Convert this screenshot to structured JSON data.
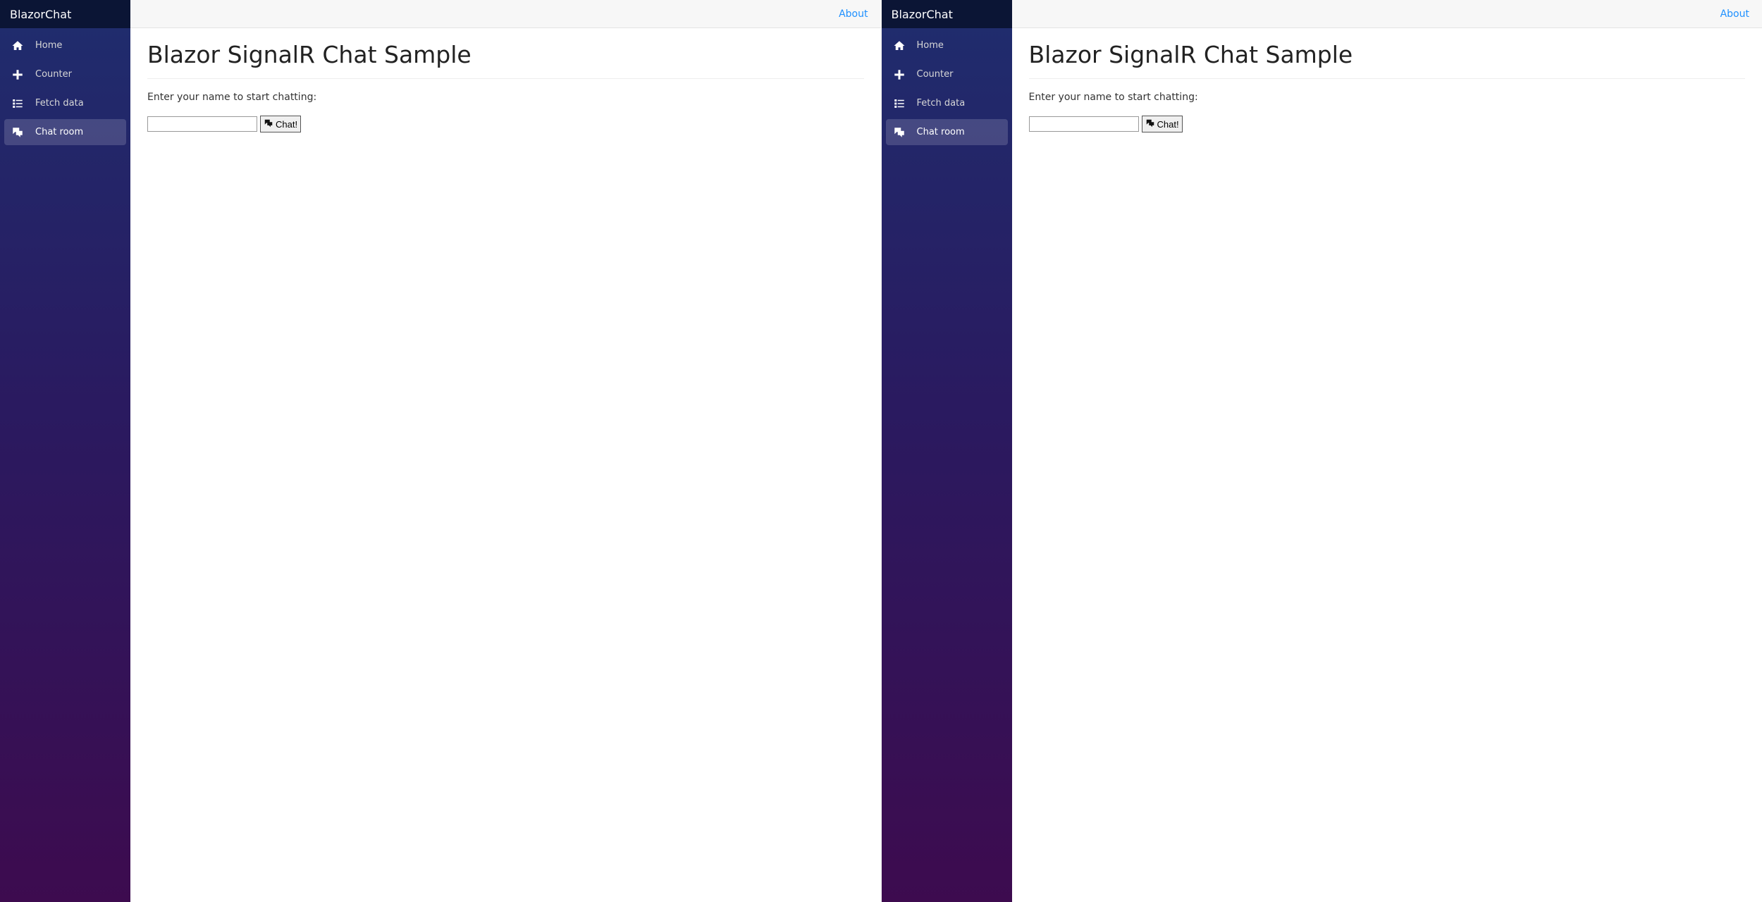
{
  "app": {
    "brand": "BlazorChat",
    "about_label": "About"
  },
  "sidebar": {
    "items": [
      {
        "label": "Home",
        "icon": "home-icon",
        "active": false
      },
      {
        "label": "Counter",
        "icon": "plus-icon",
        "active": false
      },
      {
        "label": "Fetch data",
        "icon": "list-icon",
        "active": false
      },
      {
        "label": "Chat room",
        "icon": "chat-icon",
        "active": true
      }
    ]
  },
  "page": {
    "title": "Blazor SignalR Chat Sample",
    "prompt": "Enter your name to start chatting:",
    "name_value": "",
    "chat_button_label": "Chat!"
  },
  "windows": 2
}
